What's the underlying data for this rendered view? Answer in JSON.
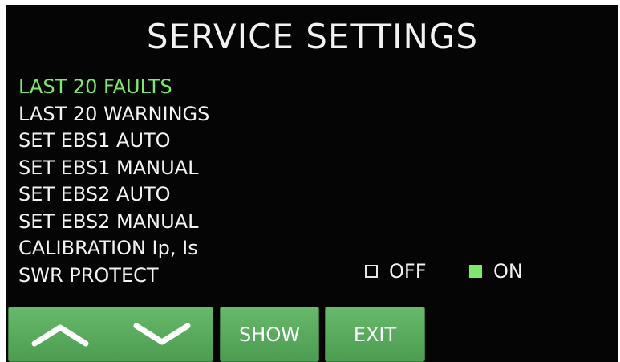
{
  "screen": {
    "title": "SERVICE SETTINGS"
  },
  "menu": {
    "items": [
      {
        "label": "LAST 20 FAULTS",
        "selected": true
      },
      {
        "label": "LAST 20 WARNINGS",
        "selected": false
      },
      {
        "label": "SET EBS1 AUTO",
        "selected": false
      },
      {
        "label": "SET EBS1 MANUAL",
        "selected": false
      },
      {
        "label": "SET EBS2 AUTO",
        "selected": false
      },
      {
        "label": "SET EBS2 MANUAL",
        "selected": false
      },
      {
        "label": "CALIBRATION Ip, Is",
        "selected": false
      },
      {
        "label": "SWR PROTECT",
        "selected": false
      }
    ]
  },
  "swr_protect": {
    "off_label": "OFF",
    "on_label": "ON",
    "value": "ON"
  },
  "buttons": {
    "up_icon": "chevron-up-icon",
    "down_icon": "chevron-down-icon",
    "show_label": "SHOW",
    "exit_label": "EXIT"
  },
  "colors": {
    "background": "#050505",
    "text": "#f2f2f2",
    "selected": "#7ee86a",
    "button": "#5aaa5f"
  }
}
